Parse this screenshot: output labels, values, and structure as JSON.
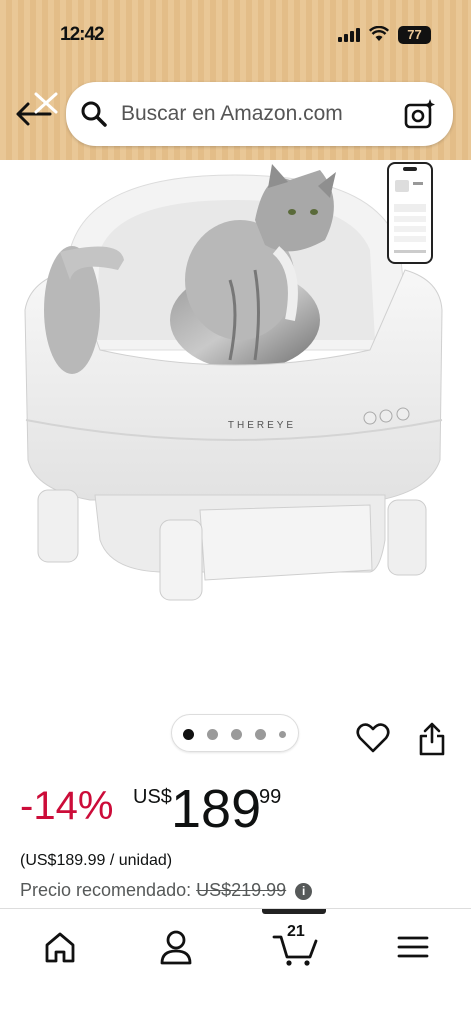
{
  "status_bar": {
    "time": "12:42",
    "battery": "77"
  },
  "search": {
    "placeholder": "Buscar en Amazon.com"
  },
  "product": {
    "brand_on_image": "THEREYE",
    "image_count": 5,
    "active_image_index": 0,
    "discount": "-14%",
    "currency": "US$",
    "price_whole": "189",
    "price_fraction": "99",
    "unit_price": "(US$189.99 / unidad)",
    "rrp_label": "Precio recomendado:",
    "rrp_value": "US$219.99"
  },
  "bottom_nav": {
    "items": [
      "home-icon",
      "account-icon",
      "cart-icon",
      "menu-icon"
    ],
    "cart_count": "21",
    "active": "cart"
  },
  "colors": {
    "header": "#e9c796",
    "discount": "#cc0c39",
    "text": "#0f1111"
  }
}
